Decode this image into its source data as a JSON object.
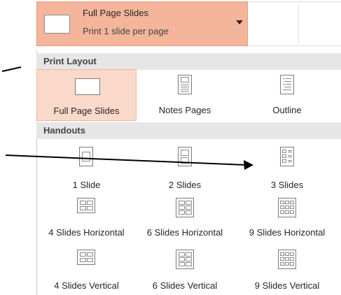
{
  "dropdown": {
    "title": "Full Page Slides",
    "subtitle": "Print 1 slide per page"
  },
  "print_layout": {
    "header": "Print Layout",
    "items": [
      {
        "label": "Full Page Slides",
        "selected": true,
        "icon": "full-page-slide-icon"
      },
      {
        "label": "Notes Pages",
        "selected": false,
        "icon": "notes-pages-icon"
      },
      {
        "label": "Outline",
        "selected": false,
        "icon": "outline-icon"
      }
    ]
  },
  "handouts": {
    "header": "Handouts",
    "items": [
      {
        "label": "1 Slide",
        "icon": "one-slide-icon"
      },
      {
        "label": "2 Slides",
        "icon": "two-slides-icon"
      },
      {
        "label": "3 Slides",
        "icon": "three-slides-icon"
      },
      {
        "label": "4 Slides Horizontal",
        "icon": "four-slides-horizontal-icon"
      },
      {
        "label": "6 Slides Horizontal",
        "icon": "six-slides-horizontal-icon"
      },
      {
        "label": "9 Slides Horizontal",
        "icon": "nine-slides-horizontal-icon"
      },
      {
        "label": "4 Slides Vertical",
        "icon": "four-slides-vertical-icon"
      },
      {
        "label": "6 Slides Vertical",
        "icon": "six-slides-vertical-icon"
      },
      {
        "label": "9 Slides Vertical",
        "icon": "nine-slides-vertical-icon"
      }
    ]
  },
  "colors": {
    "selected_bg": "#fbd9ca",
    "dropdown_bg": "#f4b59b",
    "header_bg": "#e6e6e6"
  }
}
